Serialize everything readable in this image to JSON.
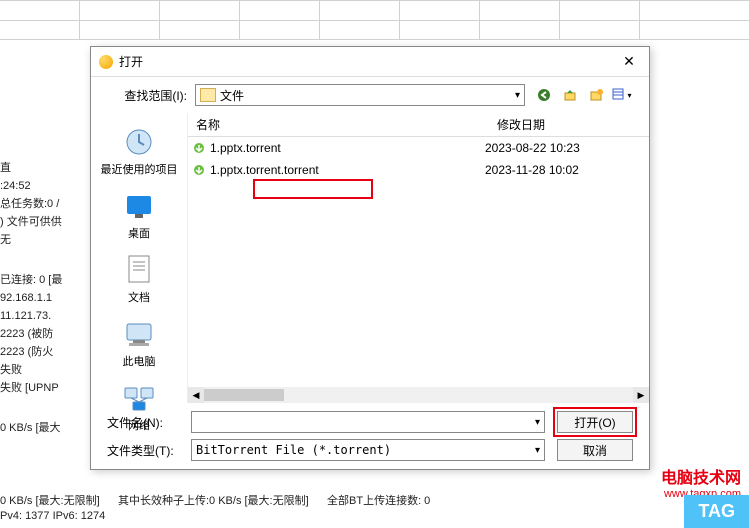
{
  "dialog": {
    "title": "打开",
    "look_in_label": "查找范围(I):",
    "look_in_value": "文件",
    "close_icon": "✕"
  },
  "sidebar": {
    "items": [
      {
        "label": "最近使用的项目"
      },
      {
        "label": "桌面"
      },
      {
        "label": "文档"
      },
      {
        "label": "此电脑"
      },
      {
        "label": "网络"
      }
    ]
  },
  "list": {
    "col_name": "名称",
    "col_date": "修改日期",
    "rows": [
      {
        "name": "1.pptx.torrent",
        "date": "2023-08-22 10:23"
      },
      {
        "name": "1.pptx.torrent.torrent",
        "date": "2023-11-28 10:02"
      }
    ]
  },
  "bottom": {
    "filename_label": "文件名(N):",
    "filename_value": "",
    "filetype_label": "文件类型(T):",
    "filetype_value": "BitTorrent File (*.torrent)",
    "open_btn": "打开(O)",
    "cancel_btn": "取消"
  },
  "bg_left": {
    "lines": [
      "直",
      ":24:52",
      "总任务数:0 /",
      ") 文件可供供",
      "无",
      "",
      "已连接: 0 [最",
      "92.168.1.1",
      "11.121.73.",
      "2223 (被防",
      "2223 (防火",
      "失败",
      "失败 [UPNP",
      "",
      "0 KB/s [最大"
    ]
  },
  "bg_bottom": {
    "line1_a": "0 KB/s [最大:无限制]",
    "line1_b": "其中长效种子上传:0 KB/s [最大:无限制]",
    "line1_c": "全部BT上传连接数: 0",
    "line2": "Pv4: 1377   IPv6: 1274"
  },
  "watermark": {
    "cn": "电脑技术网",
    "en": "www.tagxp.com"
  },
  "tag": "TAG"
}
